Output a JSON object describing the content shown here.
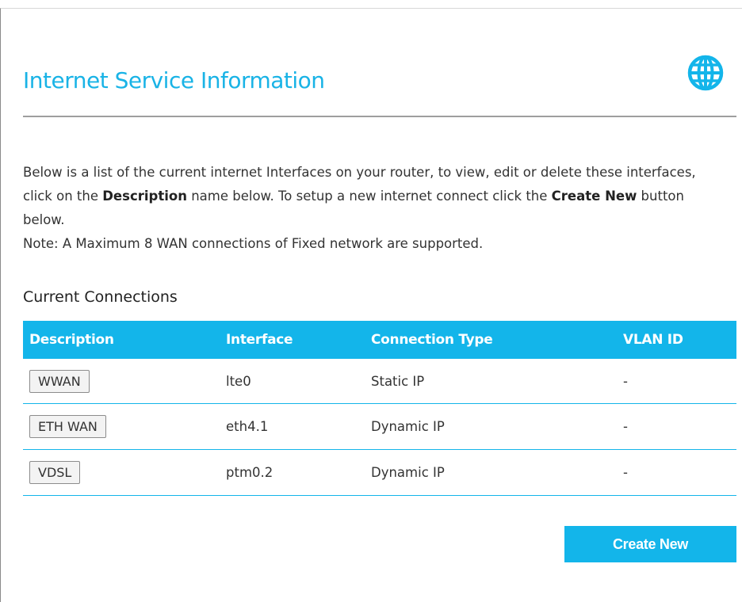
{
  "page": {
    "title": "Internet Service Information",
    "icon": "globe-icon",
    "accent_color": "#13b5ea"
  },
  "intro": {
    "line_part1": "Below is a list of the current internet Interfaces on your router, to view, edit or delete these interfaces, click on the ",
    "desc_word": "Description",
    "line_part2": " name below. To setup a new internet connect click the ",
    "create_word": "Create New",
    "line_part3": " button below.",
    "note": "Note: A Maximum 8 WAN connections of Fixed network are supported."
  },
  "connections": {
    "section_title": "Current Connections",
    "headers": {
      "description": "Description",
      "interface": "Interface",
      "connection_type": "Connection Type",
      "vlan_id": "VLAN ID"
    },
    "rows": [
      {
        "description": "WWAN",
        "interface": "lte0",
        "connection_type": "Static IP",
        "vlan_id": "-"
      },
      {
        "description": "ETH WAN",
        "interface": "eth4.1",
        "connection_type": "Dynamic IP",
        "vlan_id": "-"
      },
      {
        "description": "VDSL",
        "interface": "ptm0.2",
        "connection_type": "Dynamic IP",
        "vlan_id": "-"
      }
    ]
  },
  "actions": {
    "create_new_label": "Create New"
  }
}
